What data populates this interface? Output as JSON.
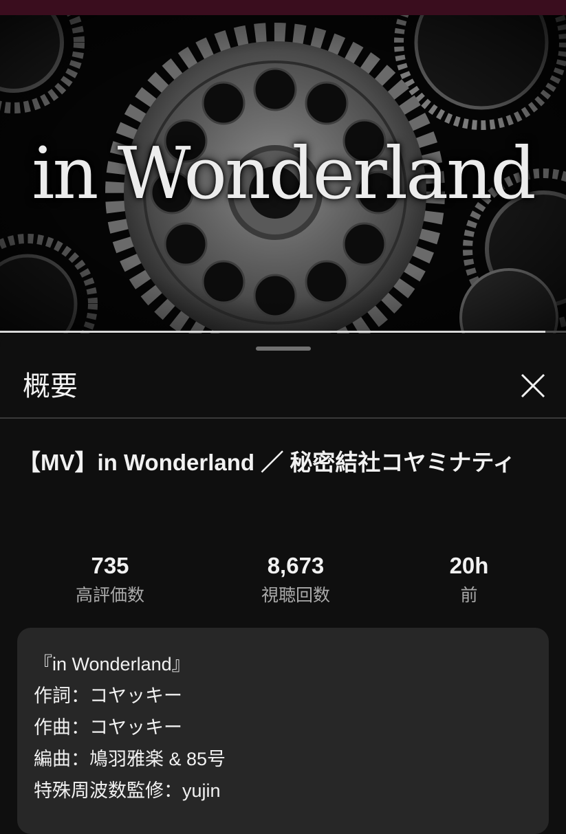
{
  "video": {
    "title_art": "in Wonderland",
    "progress": 0.963
  },
  "sheet": {
    "title": "概要"
  },
  "details": {
    "title": "【MV】in Wonderland ／ 秘密結社コヤミナティ",
    "stats": [
      {
        "value": "735",
        "label": "高評価数"
      },
      {
        "value": "8,673",
        "label": "視聴回数"
      },
      {
        "value": "20h",
        "label": "前"
      }
    ]
  },
  "description": {
    "lines": [
      "『in Wonderland』",
      "作詞：コヤッキー",
      "作曲：コヤッキー",
      "編曲：鳩羽雅楽 & 85号",
      "特殊周波数監修：yujin"
    ]
  },
  "icons": {
    "close": "close-icon"
  },
  "colors": {
    "status_bar": "#3a0d1e",
    "background": "#0f0f0f",
    "description_box": "#272727",
    "secondary_text": "#aaaaaa"
  }
}
